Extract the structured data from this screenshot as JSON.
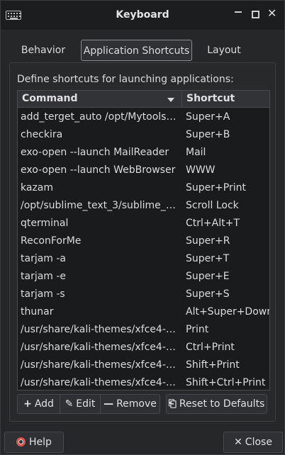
{
  "window": {
    "title": "Keyboard"
  },
  "titlebar": {
    "minimize_icon": "minimize-icon",
    "maximize_icon": "maximize-icon",
    "close_glyph": "✕"
  },
  "tabs": [
    {
      "label": "Behavior",
      "active": false
    },
    {
      "label": "Application Shortcuts",
      "active": true
    },
    {
      "label": "Layout",
      "active": false
    }
  ],
  "panel": {
    "description": "Define shortcuts for launching applications:"
  },
  "table": {
    "columns": {
      "command": "Command",
      "shortcut": "Shortcut"
    },
    "rows": [
      {
        "command": "add_terget_auto /opt/Mytools/bl…",
        "shortcut": "Super+A"
      },
      {
        "command": "checkira",
        "shortcut": "Super+B"
      },
      {
        "command": "exo-open --launch MailReader",
        "shortcut": "Mail"
      },
      {
        "command": "exo-open --launch WebBrowser",
        "shortcut": "WWW"
      },
      {
        "command": "kazam",
        "shortcut": "Super+Print"
      },
      {
        "command": "/opt/sublime_text_3/sublime_te…",
        "shortcut": "Scroll Lock"
      },
      {
        "command": "qterminal",
        "shortcut": "Ctrl+Alt+T"
      },
      {
        "command": "ReconForMe",
        "shortcut": "Super+R"
      },
      {
        "command": "tarjam -a",
        "shortcut": "Super+T"
      },
      {
        "command": "tarjam -e",
        "shortcut": "Super+E"
      },
      {
        "command": "tarjam -s",
        "shortcut": "Super+S"
      },
      {
        "command": "thunar",
        "shortcut": "Alt+Super+Down"
      },
      {
        "command": "/usr/share/kali-themes/xfce4-sc…",
        "shortcut": "Print"
      },
      {
        "command": "/usr/share/kali-themes/xfce4-sc…",
        "shortcut": "Ctrl+Print"
      },
      {
        "command": "/usr/share/kali-themes/xfce4-sc…",
        "shortcut": "Shift+Print"
      },
      {
        "command": "/usr/share/kali-themes/xfce4-sc…",
        "shortcut": "Shift+Ctrl+Print"
      }
    ]
  },
  "actions": {
    "add": "Add",
    "edit": "Edit",
    "remove": "Remove",
    "reset": "Reset to Defaults"
  },
  "footer": {
    "help": "Help",
    "close": "Close"
  },
  "colors": {
    "background": "#262729",
    "titlebar": "#1c1d1f",
    "help_icon": "#d9534f"
  }
}
